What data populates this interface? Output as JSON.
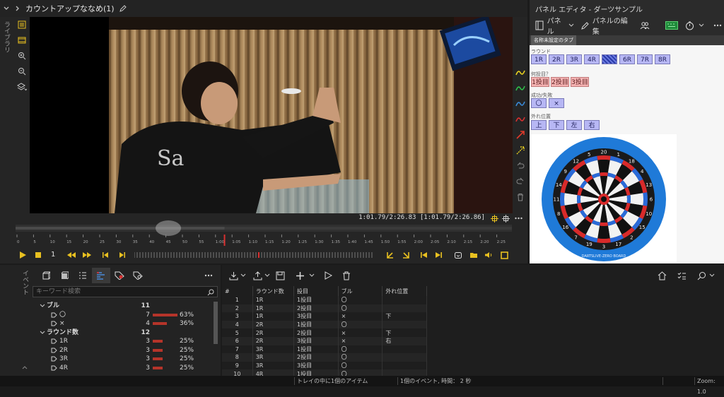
{
  "video": {
    "title": "カウントアップななめ(1)",
    "side_label": "ライブラリ",
    "time_readout": "1:01.79/2:26.83 [1:01.79/2:26.86]",
    "speed": "1",
    "ruler_ticks": [
      "0",
      "5",
      "10",
      "15",
      "20",
      "25",
      "30",
      "35",
      "40",
      "45",
      "50",
      "55",
      "1:00",
      "1:05",
      "1:10",
      "1:15",
      "1:20",
      "1:25",
      "1:30",
      "1:35",
      "1:40",
      "1:45",
      "1:50",
      "1:55",
      "2:00",
      "2:05",
      "2:10",
      "2:15",
      "2:20",
      "2:25"
    ],
    "playhead_fraction": 0.421,
    "colors": {
      "pen_yellow": "#e8d020",
      "pen_green": "#2ec04a",
      "pen_blue": "#3a8ad8",
      "pen_red": "#d83030",
      "arrow_red": "#e03a2a",
      "arrow_yellow": "#e8d020",
      "transport": "#e8c020"
    }
  },
  "panel_editor": {
    "title": "パネル エディタ - ダーツサンプル",
    "panel_label": "パネル",
    "edit_label": "パネルの編集",
    "tab_label": "名称未設定のタブ",
    "round_label": "ラウンド",
    "rounds": [
      "1R",
      "2R",
      "3R",
      "4R",
      "5R",
      "6R",
      "7R",
      "8R"
    ],
    "throw_label": "何投目？",
    "throws": [
      "1投目",
      "2投目",
      "3投目"
    ],
    "result_label": "成功/失敗",
    "results": [
      "〇",
      "×"
    ],
    "miss_label": "外れ位置",
    "misses": [
      "上",
      "下",
      "左",
      "右"
    ],
    "board_numbers": [
      "20",
      "1",
      "18",
      "4",
      "13",
      "6",
      "10",
      "15",
      "2",
      "17",
      "3",
      "19",
      "7",
      "16",
      "8",
      "11",
      "14",
      "9",
      "12",
      "5"
    ],
    "board_brand": "DARTSLIVE-ZERO BOARD"
  },
  "events": {
    "side_label": "イベント",
    "search_placeholder": "キーワード検索",
    "tree": [
      {
        "type": "group",
        "label": "ブル",
        "count": "11"
      },
      {
        "type": "item",
        "label": "〇",
        "count": "7",
        "fraction": 0.63,
        "pct": "63%"
      },
      {
        "type": "item",
        "label": "×",
        "count": "4",
        "fraction": 0.36,
        "pct": "36%"
      },
      {
        "type": "group",
        "label": "ラウンド数",
        "count": "12"
      },
      {
        "type": "item",
        "label": "1R",
        "count": "3",
        "fraction": 0.25,
        "pct": "25%"
      },
      {
        "type": "item",
        "label": "2R",
        "count": "3",
        "fraction": 0.25,
        "pct": "25%"
      },
      {
        "type": "item",
        "label": "3R",
        "count": "3",
        "fraction": 0.25,
        "pct": "25%"
      },
      {
        "type": "item",
        "label": "4R",
        "count": "3",
        "fraction": 0.25,
        "pct": "25%"
      }
    ]
  },
  "table": {
    "headers": [
      "#",
      "ラウンド数",
      "投目",
      "ブル",
      "外れ位置"
    ],
    "rows": [
      [
        "1",
        "1R",
        "1投目",
        "〇",
        ""
      ],
      [
        "2",
        "1R",
        "2投目",
        "〇",
        ""
      ],
      [
        "3",
        "1R",
        "3投目",
        "×",
        "下"
      ],
      [
        "4",
        "2R",
        "1投目",
        "〇",
        ""
      ],
      [
        "5",
        "2R",
        "2投目",
        "×",
        "下"
      ],
      [
        "6",
        "2R",
        "3投目",
        "×",
        "右"
      ],
      [
        "7",
        "3R",
        "1投目",
        "〇",
        ""
      ],
      [
        "8",
        "3R",
        "2投目",
        "〇",
        ""
      ],
      [
        "9",
        "3R",
        "3投目",
        "〇",
        ""
      ],
      [
        "10",
        "4R",
        "1投目",
        "〇",
        ""
      ]
    ]
  },
  "status": {
    "tray": "トレイの中に1個のアイテム",
    "events_info": "1個のイベント, 時間： 2 秒",
    "zoom": "Zoom: 1.0"
  }
}
